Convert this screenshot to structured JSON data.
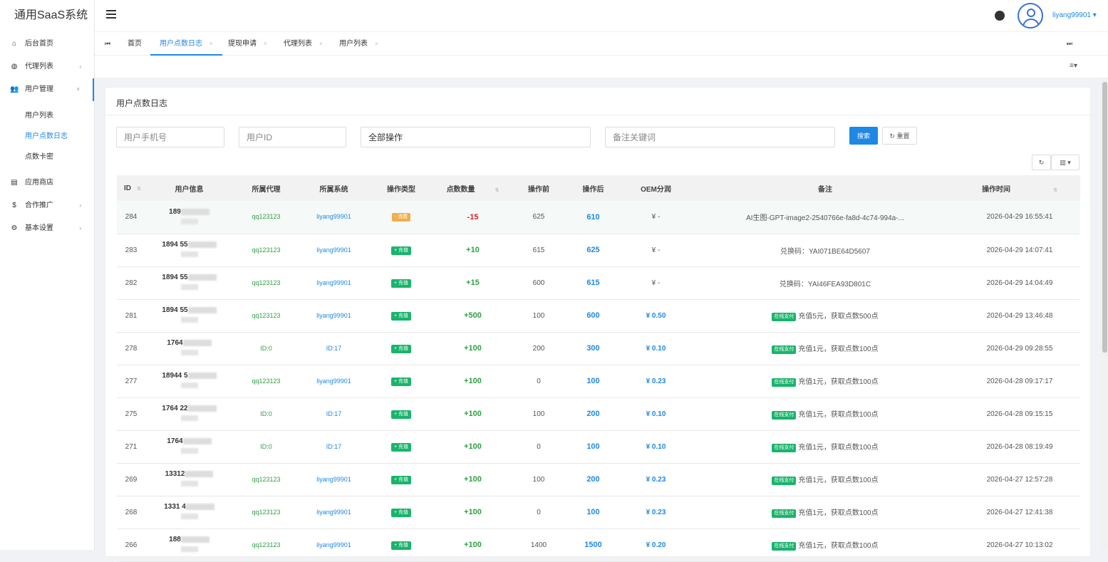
{
  "app": {
    "title": "通用SaaS系统",
    "username": "liyang99901"
  },
  "sidebar": {
    "items": [
      {
        "label": "后台首页",
        "icon": "home-icon"
      },
      {
        "label": "代理列表",
        "icon": "globe-icon"
      },
      {
        "label": "用户管理",
        "icon": "users-icon"
      },
      {
        "label": "应用商店",
        "icon": "store-icon"
      },
      {
        "label": "合作推广",
        "icon": "dollar-icon"
      },
      {
        "label": "基本设置",
        "icon": "gear-icon"
      }
    ],
    "sub_items": [
      {
        "label": "用户列表"
      },
      {
        "label": "用户点数日志"
      },
      {
        "label": "点数卡密"
      }
    ]
  },
  "tabs": [
    "首页",
    "用户点数日志",
    "提现申请",
    "代理列表",
    "用户列表"
  ],
  "card": {
    "title": "用户点数日志"
  },
  "filters": {
    "phone_placeholder": "用户手机号",
    "uid_placeholder": "用户ID",
    "op_value": "全部操作",
    "remark_placeholder": "备注关键词",
    "search_label": "搜索",
    "reset_label": "重置"
  },
  "table": {
    "headers": [
      "ID",
      "用户信息",
      "所属代理",
      "所属系统",
      "操作类型",
      "点数数量",
      "操作前",
      "操作后",
      "OEM分润",
      "备注",
      "操作时间"
    ],
    "rows": [
      {
        "id": "284",
        "phone": "189",
        "agent": "qq123123",
        "sys": "liyang99901",
        "type": "- 消费",
        "pts": "-15",
        "before": "625",
        "after": "610",
        "oem": "¥ -",
        "pay": "",
        "remark": "AI生图-GPT-image2-2540766e-fa8d-4c74-994a-...",
        "time": "2026-04-29 16:55:41"
      },
      {
        "id": "283",
        "phone": "1894   55",
        "agent": "qq123123",
        "sys": "liyang99901",
        "type": "+ 充值",
        "pts": "+10",
        "before": "615",
        "after": "625",
        "oem": "¥ -",
        "pay": "",
        "remark": "兑换码：YAI071BE64D5607",
        "time": "2026-04-29 14:07:41"
      },
      {
        "id": "282",
        "phone": "1894   55",
        "agent": "qq123123",
        "sys": "liyang99901",
        "type": "+ 充值",
        "pts": "+15",
        "before": "600",
        "after": "615",
        "oem": "¥ -",
        "pay": "",
        "remark": "兑换码：YAI46FEA93D801C",
        "time": "2026-04-29 14:04:49"
      },
      {
        "id": "281",
        "phone": "1894   55",
        "agent": "qq123123",
        "sys": "liyang99901",
        "type": "+ 充值",
        "pts": "+500",
        "before": "100",
        "after": "600",
        "oem": "¥ 0.50",
        "pay": "在线支付",
        "remark": "充值5元，获取点数500点",
        "time": "2026-04-29 13:46:48"
      },
      {
        "id": "278",
        "phone": "1764",
        "agent": "ID:0",
        "sys": "ID:17",
        "type": "+ 充值",
        "pts": "+100",
        "before": "200",
        "after": "300",
        "oem": "¥ 0.10",
        "pay": "在线支付",
        "remark": "充值1元，获取点数100点",
        "time": "2026-04-29 09:28:55"
      },
      {
        "id": "277",
        "phone": "18944   5",
        "agent": "qq123123",
        "sys": "liyang99901",
        "type": "+ 充值",
        "pts": "+100",
        "before": "0",
        "after": "100",
        "oem": "¥ 0.23",
        "pay": "在线支付",
        "remark": "充值1元，获取点数100点",
        "time": "2026-04-28 09:17:17"
      },
      {
        "id": "275",
        "phone": "1764   22",
        "agent": "ID:0",
        "sys": "ID:17",
        "type": "+ 充值",
        "pts": "+100",
        "before": "100",
        "after": "200",
        "oem": "¥ 0.10",
        "pay": "在线支付",
        "remark": "充值1元，获取点数100点",
        "time": "2026-04-28 09:15:15"
      },
      {
        "id": "271",
        "phone": "1764",
        "agent": "ID:0",
        "sys": "ID:17",
        "type": "+ 充值",
        "pts": "+100",
        "before": "0",
        "after": "100",
        "oem": "¥ 0.10",
        "pay": "在线支付",
        "remark": "充值1元，获取点数100点",
        "time": "2026-04-28 08:19:49"
      },
      {
        "id": "269",
        "phone": "13312",
        "agent": "qq123123",
        "sys": "liyang99901",
        "type": "+ 充值",
        "pts": "+100",
        "before": "100",
        "after": "200",
        "oem": "¥ 0.23",
        "pay": "在线支付",
        "remark": "充值1元，获取点数100点",
        "time": "2026-04-27 12:57:28"
      },
      {
        "id": "268",
        "phone": "1331   4",
        "agent": "qq123123",
        "sys": "liyang99901",
        "type": "+ 充值",
        "pts": "+100",
        "before": "0",
        "after": "100",
        "oem": "¥ 0.23",
        "pay": "在线支付",
        "remark": "充值1元，获取点数100点",
        "time": "2026-04-27 12:41:38"
      },
      {
        "id": "266",
        "phone": "188",
        "agent": "qq123123",
        "sys": "liyang99901",
        "type": "+ 充值",
        "pts": "+100",
        "before": "1400",
        "after": "1500",
        "oem": "¥ 0.20",
        "pay": "在线支付",
        "remark": "充值1元，获取点数100点",
        "time": "2026-04-27 10:13:02"
      }
    ]
  },
  "colors": {
    "accent": "#1e88e5",
    "consume": "#f0ad4e",
    "recharge": "#19b46b",
    "negative": "#e02020",
    "positive": "#2ea043"
  }
}
